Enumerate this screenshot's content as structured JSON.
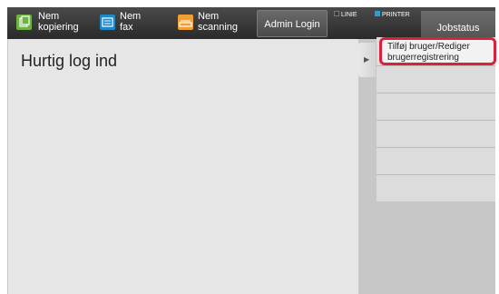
{
  "topbar": {
    "shortcuts": [
      {
        "label": "Nem\nkopiering",
        "icon": "copy-icon",
        "color": "#6cb33f"
      },
      {
        "label": "Nem\nfax",
        "icon": "fax-icon",
        "color": "#1e88c8"
      },
      {
        "label": "Nem\nscanning",
        "icon": "scan-icon",
        "color": "#f0a030"
      }
    ],
    "admin_login_label": "Admin Login",
    "indicators": [
      {
        "label": "LINIE",
        "color": "#555555"
      },
      {
        "label": "PRINTER",
        "color": "#2a9fd6"
      }
    ],
    "jobstatus_label": "Jobstatus"
  },
  "main": {
    "title": "Hurtig log ind"
  },
  "menu": {
    "items": [
      {
        "label": "Tilføj bruger/Rediger\nbrugerregistrering",
        "highlight_color": "#d6223b"
      },
      {
        "label": ""
      },
      {
        "label": ""
      },
      {
        "label": ""
      },
      {
        "label": ""
      },
      {
        "label": ""
      }
    ]
  }
}
